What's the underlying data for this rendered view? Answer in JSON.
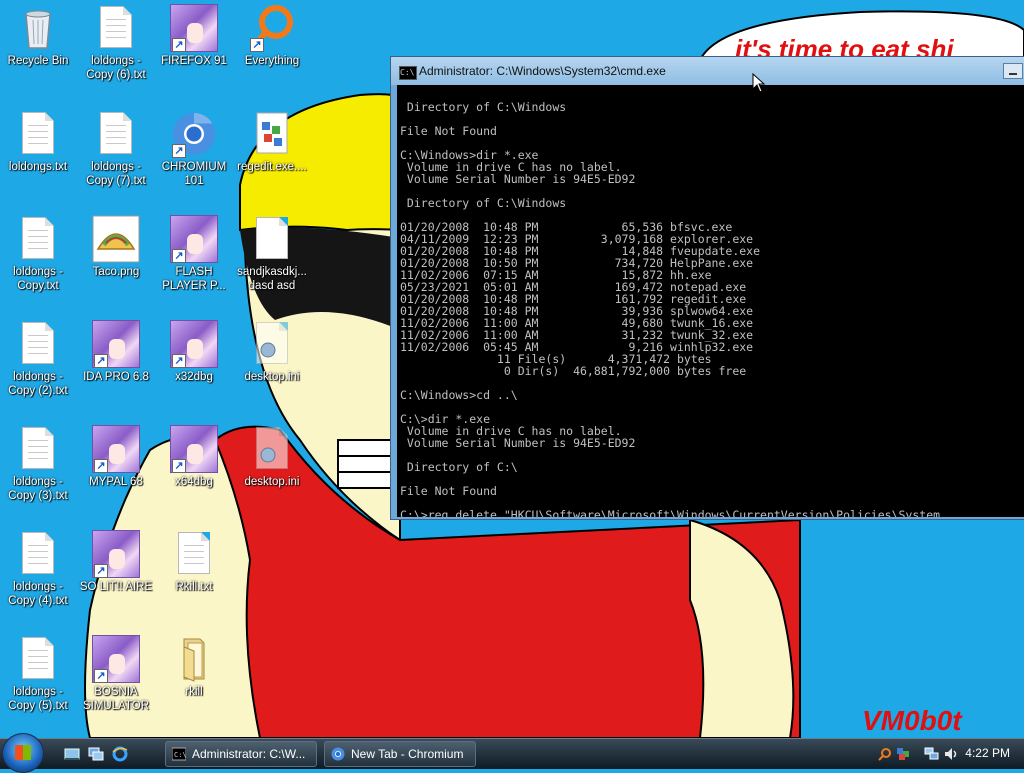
{
  "wallpaper": {
    "banner_text": "it's time to eat shi",
    "signature": "VM0b0t"
  },
  "desktop_icons": [
    {
      "label": "Recycle Bin",
      "type": "recycle"
    },
    {
      "label": "loldongs - Copy (6).txt",
      "type": "file"
    },
    {
      "label": "FIREFOX 91",
      "type": "anime"
    },
    {
      "label": "Everything",
      "type": "everything"
    },
    {
      "label": "loldongs.txt",
      "type": "file"
    },
    {
      "label": "loldongs - Copy (7).txt",
      "type": "file"
    },
    {
      "label": "CHROMIUM 101",
      "type": "chromium"
    },
    {
      "label": "regedit.exe....",
      "type": "regedit"
    },
    {
      "label": "loldongs - Copy.txt",
      "type": "file"
    },
    {
      "label": "Taco.png",
      "type": "taco"
    },
    {
      "label": "FLASH PLAYER P...",
      "type": "anime"
    },
    {
      "label": "sandjkasdkj... dasd asd",
      "type": "file"
    },
    {
      "label": "loldongs - Copy (2).txt",
      "type": "file"
    },
    {
      "label": "IDA PRO 6.8",
      "type": "anime"
    },
    {
      "label": "x32dbg",
      "type": "anime"
    },
    {
      "label": "desktop.ini",
      "type": "ini"
    },
    {
      "label": "loldongs - Copy (3).txt",
      "type": "file"
    },
    {
      "label": "MYPAL 68",
      "type": "anime"
    },
    {
      "label": "x64dbg",
      "type": "anime"
    },
    {
      "label": "desktop.ini",
      "type": "ini"
    },
    {
      "label": "loldongs - Copy (4).txt",
      "type": "file"
    },
    {
      "label": "SO LIT!! AIRE",
      "type": "anime"
    },
    {
      "label": "Rkill.txt",
      "type": "file"
    },
    {
      "label": "loldongs - Copy (5).txt",
      "type": "file"
    },
    {
      "label": "BOSNIA SIMULATOR",
      "type": "anime"
    },
    {
      "label": "rkill",
      "type": "folder"
    }
  ],
  "cmd_window": {
    "title": "Administrator: C:\\Windows\\System32\\cmd.exe",
    "lines": [
      "",
      " Directory of C:\\Windows",
      "",
      "File Not Found",
      "",
      "C:\\Windows>dir *.exe",
      " Volume in drive C has no label.",
      " Volume Serial Number is 94E5-ED92",
      "",
      " Directory of C:\\Windows",
      "",
      "01/20/2008  10:48 PM            65,536 bfsvc.exe",
      "04/11/2009  12:23 PM         3,079,168 explorer.exe",
      "01/20/2008  10:48 PM            14,848 fveupdate.exe",
      "01/20/2008  10:50 PM           734,720 HelpPane.exe",
      "11/02/2006  07:15 AM            15,872 hh.exe",
      "05/23/2021  05:01 AM           169,472 notepad.exe",
      "01/20/2008  10:48 PM           161,792 regedit.exe",
      "01/20/2008  10:48 PM            39,936 splwow64.exe",
      "11/02/2006  11:00 AM            49,680 twunk_16.exe",
      "11/02/2006  11:00 AM            31,232 twunk_32.exe",
      "11/02/2006  05:45 AM             9,216 winhlp32.exe",
      "              11 File(s)      4,371,472 bytes",
      "               0 Dir(s)  46,881,792,000 bytes free",
      "",
      "C:\\Windows>cd ..\\",
      "",
      "C:\\>dir *.exe",
      " Volume in drive C has no label.",
      " Volume Serial Number is 94E5-ED92",
      "",
      " Directory of C:\\",
      "",
      "File Not Found",
      "",
      "C:\\>reg delete \"HKCU\\Software\\Microsoft\\Windows\\CurrentVersion\\Policies\\System"
    ]
  },
  "taskbar": {
    "start_label": "Start",
    "quicklaunch": [
      "show-desktop-icon",
      "switch-windows-icon",
      "internet-explorer-icon"
    ],
    "buttons": [
      {
        "label": "Administrator: C:\\W...",
        "icon": "cmd-icon"
      },
      {
        "label": "New Tab - Chromium",
        "icon": "chromium-icon"
      }
    ],
    "clock": "4:22 PM"
  }
}
